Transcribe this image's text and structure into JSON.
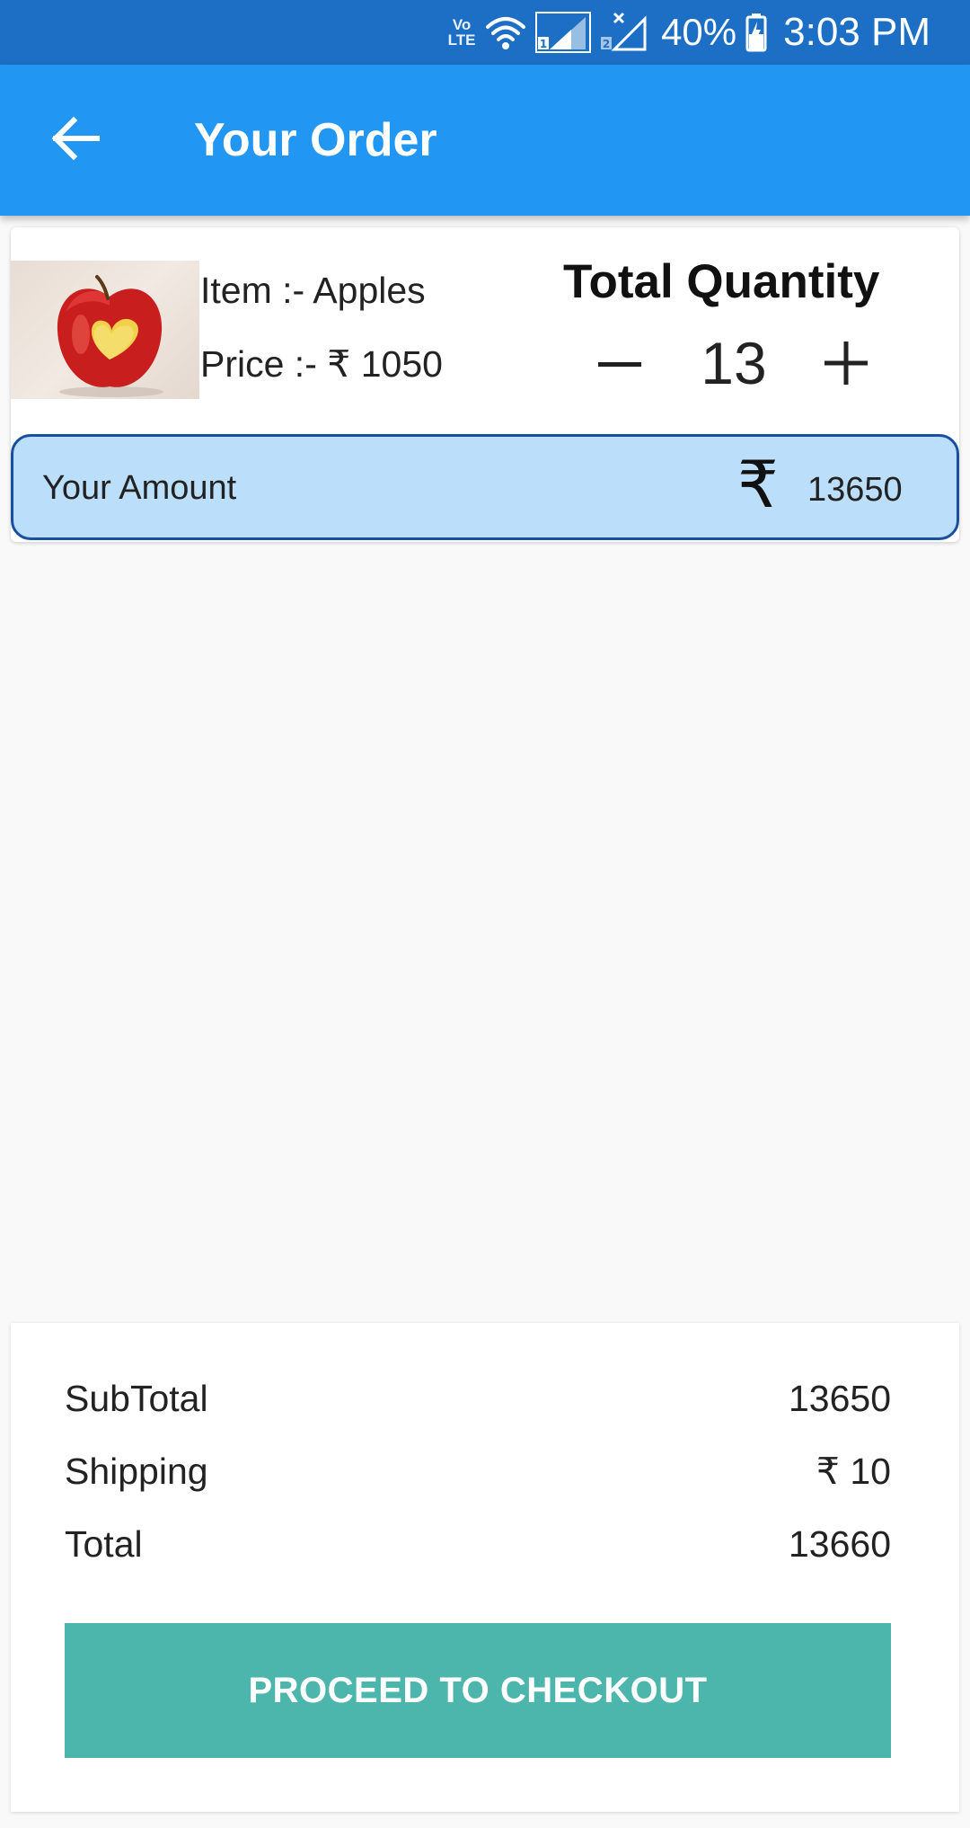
{
  "status_bar": {
    "volte_line1": "Vo",
    "volte_line2": "LTE",
    "sim1": "1",
    "sim2": "2",
    "battery": "40%",
    "time": "3:03 PM"
  },
  "app_bar": {
    "title": "Your Order"
  },
  "order_item": {
    "item_text": "Item :- Apples",
    "price_text": "Price :- ₹ 1050",
    "quantity_title": "Total Quantity",
    "quantity": "13",
    "amount_label": "Your Amount",
    "amount_currency": "₹",
    "amount_value": "13650"
  },
  "summary": {
    "subtotal_label": "SubTotal",
    "subtotal_value": "13650",
    "shipping_label": "Shipping",
    "shipping_value": "₹ 10",
    "total_label": "Total",
    "total_value": "13660",
    "checkout_label": "PROCEED TO CHECKOUT"
  },
  "colors": {
    "status_bar": "#1c6fc4",
    "app_bar": "#2196f3",
    "amount_bar": "#bbdefb",
    "amount_border": "#1a4fa0",
    "checkout_button": "#4db6ac"
  },
  "icons": {
    "back": "arrow-back-icon",
    "minus": "minus-icon",
    "plus": "plus-icon",
    "wifi": "wifi-icon",
    "signal": "signal-icon",
    "battery": "battery-charging-icon"
  }
}
